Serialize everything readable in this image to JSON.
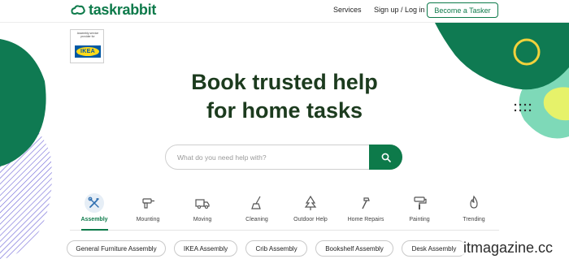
{
  "header": {
    "logo_text": "taskrabbit",
    "nav": {
      "services": "Services",
      "signup_login": "Sign up / Log in",
      "become_tasker": "Become a Tasker"
    }
  },
  "partner_badge": {
    "caption": "Assembly service provider for",
    "logo_text": "IKEA"
  },
  "hero": {
    "title_line1": "Book trusted help",
    "title_line2": "for home tasks"
  },
  "search": {
    "placeholder": "What do you need help with?",
    "button_icon": "search-icon"
  },
  "categories": [
    {
      "label": "Assembly",
      "icon": "tools-icon",
      "active": true
    },
    {
      "label": "Mounting",
      "icon": "drill-icon",
      "active": false
    },
    {
      "label": "Moving",
      "icon": "truck-icon",
      "active": false
    },
    {
      "label": "Cleaning",
      "icon": "broom-icon",
      "active": false
    },
    {
      "label": "Outdoor Help",
      "icon": "tree-icon",
      "active": false
    },
    {
      "label": "Home Repairs",
      "icon": "hammer-icon",
      "active": false
    },
    {
      "label": "Painting",
      "icon": "paint-roller-icon",
      "active": false
    },
    {
      "label": "Trending",
      "icon": "flame-icon",
      "active": false
    }
  ],
  "chips": [
    "General Furniture Assembly",
    "IKEA Assembly",
    "Crib Assembly",
    "Bookshelf Assembly",
    "Desk Assembly"
  ],
  "watermark": "itmagazine.cc",
  "colors": {
    "brand_green": "#0d7a4a",
    "heading_dark_green": "#1c3b1e",
    "mint": "#7ed9b8",
    "lime": "#e6f26a",
    "ring_yellow": "#f2d23c",
    "stripe_purple": "#6b62d6"
  }
}
